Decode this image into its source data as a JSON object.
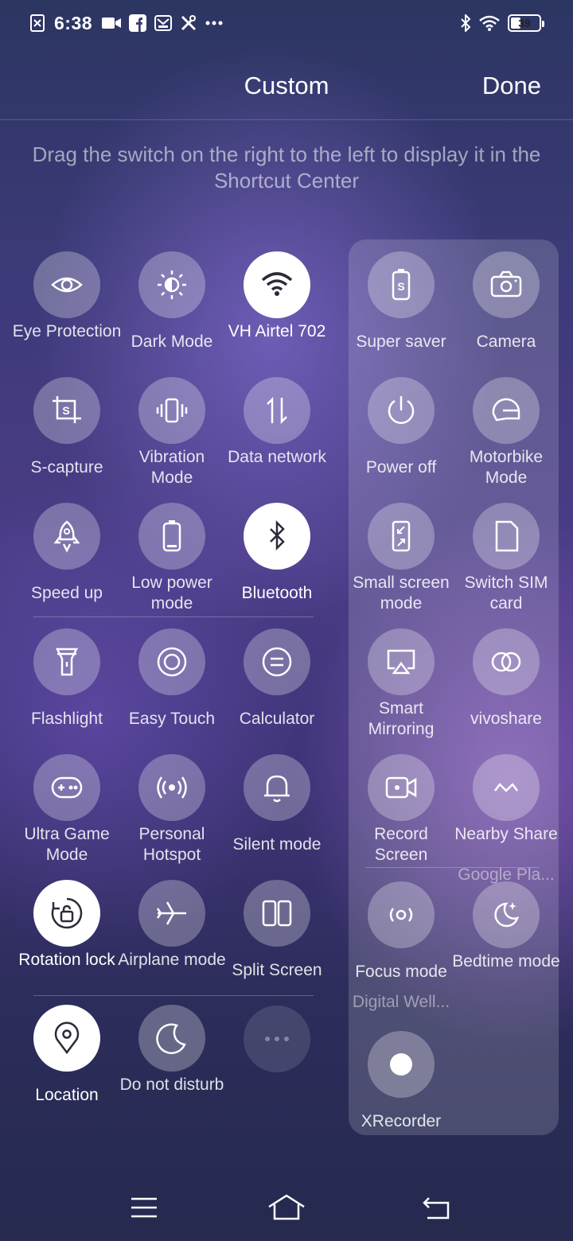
{
  "status_bar": {
    "time": "6:38",
    "battery": "39",
    "left_icons": [
      "screenshot-icon",
      "video-icon",
      "facebook-icon",
      "mail-icon",
      "tools-icon",
      "more-dots-icon"
    ],
    "right_icons": [
      "bluetooth-icon",
      "wifi-icon",
      "battery-icon"
    ]
  },
  "header": {
    "title": "Custom",
    "done_label": "Done",
    "instruction": "Drag the switch on the right to the left to display it in the Shortcut Center"
  },
  "left_tiles": [
    {
      "label": "Eye Protection",
      "icon": "eye-icon",
      "active": false
    },
    {
      "label": "Dark Mode",
      "icon": "dark-mode-icon",
      "active": false
    },
    {
      "label": "VH Airtel 702",
      "icon": "wifi-icon",
      "active": true
    },
    {
      "label": "S-capture",
      "icon": "s-capture-icon",
      "active": false
    },
    {
      "label": "Vibration Mode",
      "icon": "vibration-icon",
      "active": false
    },
    {
      "label": "Data network",
      "icon": "data-network-icon",
      "active": false
    },
    {
      "label": "Speed up",
      "icon": "rocket-icon",
      "active": false
    },
    {
      "label": "Low power mode",
      "icon": "battery-low-icon",
      "active": false
    },
    {
      "label": "Bluetooth",
      "icon": "bluetooth-icon",
      "active": true
    },
    {
      "label": "Flashlight",
      "icon": "flashlight-icon",
      "active": false
    },
    {
      "label": "Easy Touch",
      "icon": "easy-touch-icon",
      "active": false
    },
    {
      "label": "Calculator",
      "icon": "calculator-icon",
      "active": false
    },
    {
      "label": "Ultra Game Mode",
      "icon": "gamepad-icon",
      "active": false
    },
    {
      "label": "Personal Hotspot",
      "icon": "hotspot-icon",
      "active": false
    },
    {
      "label": "Silent mode",
      "icon": "bell-icon",
      "active": false
    },
    {
      "label": "Rotation lock",
      "icon": "rotation-lock-icon",
      "active": true
    },
    {
      "label": "Airplane mode",
      "icon": "airplane-icon",
      "active": false
    },
    {
      "label": "Split Screen",
      "icon": "split-screen-icon",
      "active": false
    },
    {
      "label": "Location",
      "icon": "location-icon",
      "active": true
    },
    {
      "label": "Do not disturb",
      "icon": "moon-icon",
      "active": false
    },
    {
      "label": "",
      "icon": "more-dots-icon",
      "active": false
    }
  ],
  "right_tiles": [
    {
      "label": "Super saver",
      "icon": "super-saver-icon",
      "sub": ""
    },
    {
      "label": "Camera",
      "icon": "camera-icon",
      "sub": ""
    },
    {
      "label": "Power off",
      "icon": "power-icon",
      "sub": ""
    },
    {
      "label": "Motorbike Mode",
      "icon": "helmet-icon",
      "sub": ""
    },
    {
      "label": "Small screen mode",
      "icon": "small-screen-icon",
      "sub": ""
    },
    {
      "label": "Switch SIM card",
      "icon": "sim-card-icon",
      "sub": ""
    },
    {
      "label": "Smart Mirroring",
      "icon": "screen-mirror-icon",
      "sub": ""
    },
    {
      "label": "vivoshare",
      "icon": "vivoshare-icon",
      "sub": ""
    },
    {
      "label": "Record Screen",
      "icon": "record-screen-icon",
      "sub": ""
    },
    {
      "label": "Nearby Share",
      "icon": "nearby-share-icon",
      "sub": "Google Pla..."
    },
    {
      "label": "Focus mode",
      "icon": "focus-mode-icon",
      "sub": "Digital Well..."
    },
    {
      "label": "Bedtime mode",
      "icon": "bedtime-icon",
      "sub": ""
    },
    {
      "label": "XRecorder",
      "icon": "xrecorder-icon",
      "sub": ""
    }
  ],
  "nav_bar": {
    "buttons": [
      "menu-icon",
      "home-icon",
      "back-icon"
    ]
  }
}
